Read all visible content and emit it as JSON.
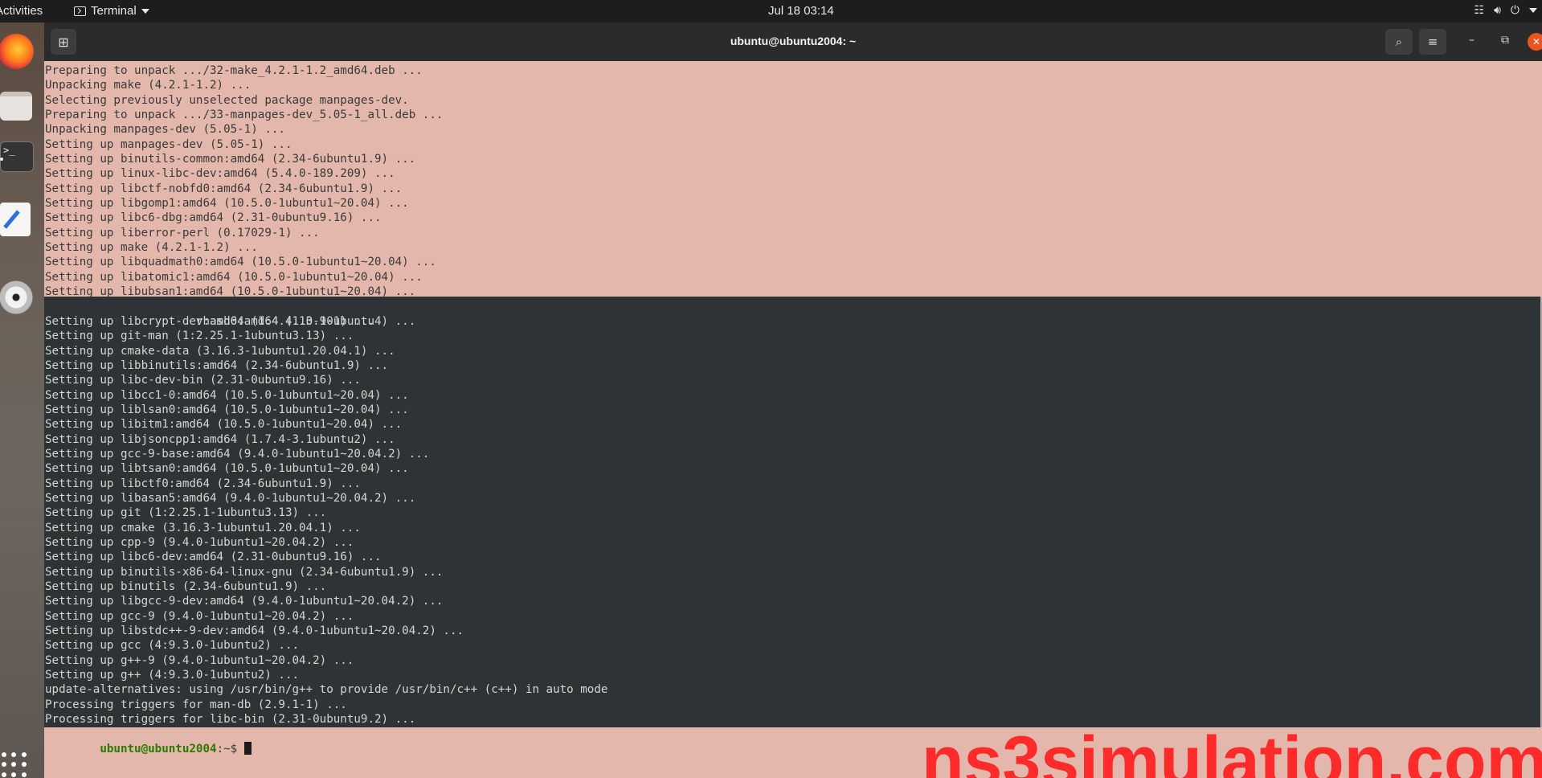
{
  "topbar": {
    "activities": "Activities",
    "app_name": "Terminal",
    "clock": "Jul 18  03:14"
  },
  "window": {
    "title": "ubuntu@ubuntu2004: ~"
  },
  "terminal": {
    "light_lines": [
      "Preparing to unpack .../32-make_4.2.1-1.2_amd64.deb ...",
      "Unpacking make (4.2.1-1.2) ...",
      "Selecting previously unselected package manpages-dev.",
      "Preparing to unpack .../33-manpages-dev_5.05-1_all.deb ...",
      "Unpacking manpages-dev (5.05-1) ...",
      "Setting up manpages-dev (5.05-1) ...",
      "Setting up binutils-common:amd64 (2.34-6ubuntu1.9) ...",
      "Setting up linux-libc-dev:amd64 (5.4.0-189.209) ...",
      "Setting up libctf-nobfd0:amd64 (2.34-6ubuntu1.9) ...",
      "Setting up libgomp1:amd64 (10.5.0-1ubuntu1~20.04) ...",
      "Setting up libc6-dbg:amd64 (2.31-0ubuntu9.16) ...",
      "Setting up liberror-perl (0.17029-1) ...",
      "Setting up make (4.2.1-1.2) ...",
      "Setting up libquadmath0:amd64 (10.5.0-1ubuntu1~20.04) ...",
      "Setting up libatomic1:amd64 (10.5.0-1ubuntu1~20.04) ...",
      "Setting up libubsan1:amd64 (10.5.0-1ubuntu1~20.04) ..."
    ],
    "split_line_left": "Setting up lib",
    "split_line_right": "rhash0:amd64 (1.3.9-1) ...",
    "dark_lines": [
      "Setting up libcrypt-dev:amd64 (1:4.4.10-10ubuntu4) ...",
      "Setting up git-man (1:2.25.1-1ubuntu3.13) ...",
      "Setting up cmake-data (3.16.3-1ubuntu1.20.04.1) ...",
      "Setting up libbinutils:amd64 (2.34-6ubuntu1.9) ...",
      "Setting up libc-dev-bin (2.31-0ubuntu9.16) ...",
      "Setting up libcc1-0:amd64 (10.5.0-1ubuntu1~20.04) ...",
      "Setting up liblsan0:amd64 (10.5.0-1ubuntu1~20.04) ...",
      "Setting up libitm1:amd64 (10.5.0-1ubuntu1~20.04) ...",
      "Setting up libjsoncpp1:amd64 (1.7.4-3.1ubuntu2) ...",
      "Setting up gcc-9-base:amd64 (9.4.0-1ubuntu1~20.04.2) ...",
      "Setting up libtsan0:amd64 (10.5.0-1ubuntu1~20.04) ...",
      "Setting up libctf0:amd64 (2.34-6ubuntu1.9) ...",
      "Setting up libasan5:amd64 (9.4.0-1ubuntu1~20.04.2) ...",
      "Setting up git (1:2.25.1-1ubuntu3.13) ...",
      "Setting up cmake (3.16.3-1ubuntu1.20.04.1) ...",
      "Setting up cpp-9 (9.4.0-1ubuntu1~20.04.2) ...",
      "Setting up libc6-dev:amd64 (2.31-0ubuntu9.16) ...",
      "Setting up binutils-x86-64-linux-gnu (2.34-6ubuntu1.9) ...",
      "Setting up binutils (2.34-6ubuntu1.9) ...",
      "Setting up libgcc-9-dev:amd64 (9.4.0-1ubuntu1~20.04.2) ...",
      "Setting up gcc-9 (9.4.0-1ubuntu1~20.04.2) ...",
      "Setting up libstdc++-9-dev:amd64 (9.4.0-1ubuntu1~20.04.2) ...",
      "Setting up gcc (4:9.3.0-1ubuntu2) ...",
      "Setting up g++-9 (9.4.0-1ubuntu1~20.04.2) ...",
      "Setting up g++ (4:9.3.0-1ubuntu2) ...",
      "update-alternatives: using /usr/bin/g++ to provide /usr/bin/c++ (c++) in auto mode",
      "Processing triggers for man-db (2.9.1-1) ...",
      "Processing triggers for libc-bin (2.31-0ubuntu9.2) ..."
    ],
    "prompt_user": "ubuntu@ubuntu2004",
    "prompt_rest": ":~$ "
  },
  "watermark": "ns3simulation.com",
  "colors": {
    "terminal_bg_light": "#e3b7ab",
    "terminal_bg_dark": "#2e3436",
    "prompt_green": "#2a7a00",
    "watermark_red": "#ff2a2a",
    "close_orange": "#e95420"
  }
}
